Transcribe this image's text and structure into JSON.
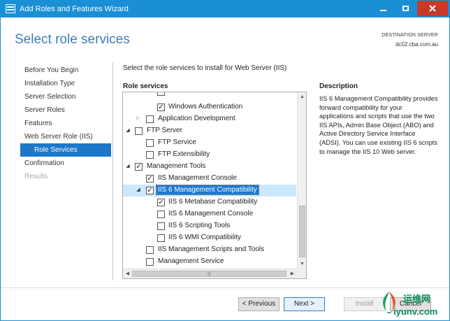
{
  "window": {
    "title": "Add Roles and Features Wizard",
    "accent": "#1b8fd6"
  },
  "header": {
    "title": "Select role services",
    "destination_label": "DESTINATION SERVER",
    "destination_server": "dc02.cba.com.au"
  },
  "nav": {
    "items": [
      {
        "label": "Before You Begin",
        "state": "normal"
      },
      {
        "label": "Installation Type",
        "state": "normal"
      },
      {
        "label": "Server Selection",
        "state": "normal"
      },
      {
        "label": "Server Roles",
        "state": "normal"
      },
      {
        "label": "Features",
        "state": "normal"
      },
      {
        "label": "Web Server Role (IIS)",
        "state": "normal"
      },
      {
        "label": "Role Services",
        "state": "active"
      },
      {
        "label": "Confirmation",
        "state": "normal"
      },
      {
        "label": "Results",
        "state": "disabled"
      }
    ]
  },
  "main": {
    "instruction": "Select the role services to install for Web Server (IIS)",
    "role_services_label": "Role services",
    "tree": [
      {
        "label": "Windows Authentication",
        "checked": true,
        "expander": ""
      },
      {
        "label": "Application Development",
        "checked": false,
        "expander": "collapsed"
      },
      {
        "label": "FTP Server",
        "checked": false,
        "expander": "expanded"
      },
      {
        "label": "FTP Service",
        "checked": false,
        "expander": ""
      },
      {
        "label": "FTP Extensibility",
        "checked": false,
        "expander": ""
      },
      {
        "label": "Management Tools",
        "checked": true,
        "expander": "expanded"
      },
      {
        "label": "IIS Management Console",
        "checked": true,
        "expander": ""
      },
      {
        "label": "IIS 6 Management Compatibility",
        "checked": true,
        "expander": "expanded",
        "selected": true
      },
      {
        "label": "IIS 6 Metabase Compatibility",
        "checked": true,
        "expander": ""
      },
      {
        "label": "IIS 6 Management Console",
        "checked": false,
        "expander": ""
      },
      {
        "label": "IIS 6 Scripting Tools",
        "checked": false,
        "expander": ""
      },
      {
        "label": "IIS 6 WMI Compatibility",
        "checked": false,
        "expander": ""
      },
      {
        "label": "IIS Management Scripts and Tools",
        "checked": false,
        "expander": ""
      },
      {
        "label": "Management Service",
        "checked": false,
        "expander": ""
      }
    ]
  },
  "description": {
    "label": "Description",
    "text": "IIS 6 Management Compatibility provides forward compatibility for your applications and scripts that use the two IIS APIs, Admin Base Object (ABO) and Active Directory Service Interface (ADSI). You can use existing IIS 6 scripts to manage the IIS 10 Web server."
  },
  "footer": {
    "previous_label": "< Previous",
    "next_label": "Next >",
    "install_label": "Install",
    "cancel_label": "Cancel"
  },
  "watermark": {
    "cn": "运维网",
    "en": "iyunv.com"
  }
}
